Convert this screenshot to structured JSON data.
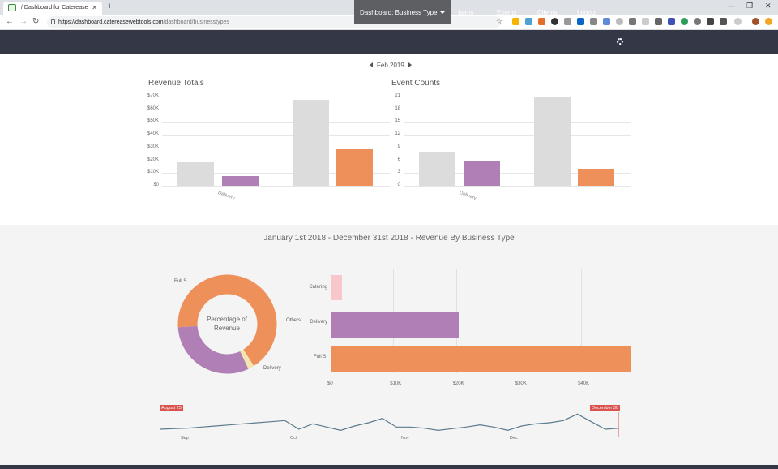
{
  "browser": {
    "tab_title": "/ Dashboard for Caterease",
    "url_host": "https://dashboard.catereasewebtools.com",
    "url_path": "/dashboard/businesstypes"
  },
  "nav": {
    "items": [
      {
        "label": "Dashboard: Business Type"
      },
      {
        "label": "Items"
      },
      {
        "label": "Events"
      },
      {
        "label": "Clients"
      },
      {
        "label": "Logout"
      }
    ]
  },
  "month_selector": {
    "label": "Feb 2019"
  },
  "colors": {
    "grey": "#dcdcdc",
    "purple": "#b07fb6",
    "orange": "#ee905a",
    "pink": "#f8c6cb",
    "cream": "#f4e4b0"
  },
  "chart_data": [
    {
      "type": "bar",
      "title": "Revenue Totals",
      "categories": [
        "Delivery",
        ""
      ],
      "yticks": [
        "$70K",
        "$60K",
        "$50K",
        "$40K",
        "$30K",
        "$20K",
        "$10K",
        "$0"
      ],
      "ylim": [
        0,
        70000
      ],
      "series": [
        {
          "values": [
            18500,
            67500
          ]
        },
        {
          "values": [
            7500,
            null
          ]
        },
        {
          "values": [
            null,
            28500
          ]
        }
      ]
    },
    {
      "type": "bar",
      "title": "Event Counts",
      "categories": [
        "Delivery",
        ""
      ],
      "yticks": [
        "21",
        "18",
        "15",
        "12",
        "9",
        "6",
        "3",
        "0"
      ],
      "ylim": [
        0,
        21
      ],
      "series": [
        {
          "values": [
            8,
            21
          ]
        },
        {
          "values": [
            6,
            null
          ]
        },
        {
          "values": [
            null,
            4
          ]
        }
      ]
    },
    {
      "type": "pie",
      "title": "January 1st 2018 - December 31st 2018 - Revenue By Business Type",
      "center_label": "Percentage of Revenue",
      "slices": [
        {
          "label": "Full S.",
          "value": 67
        },
        {
          "label": "Others",
          "value": 2
        },
        {
          "label": "Delivery",
          "value": 31
        }
      ]
    },
    {
      "type": "bar",
      "orientation": "horizontal",
      "categories": [
        "Catering",
        "Delivery",
        "Full S."
      ],
      "values": [
        1800,
        20500,
        48000
      ],
      "xticks": [
        "$0",
        "$10K",
        "$20K",
        "$30K",
        "$40K"
      ],
      "xlim": [
        0,
        48000
      ]
    },
    {
      "type": "line",
      "x_labels": [
        "Sep",
        "Oct",
        "Nov",
        "Dec"
      ],
      "range_start_label": "August 25",
      "range_end_label": "December 30",
      "values": [
        3,
        3.5,
        4,
        5,
        6,
        7,
        8,
        9,
        10,
        11,
        3,
        8,
        5,
        2,
        6,
        9,
        13,
        5,
        5,
        4,
        2,
        3.5,
        5,
        7,
        5,
        2,
        6,
        8,
        9,
        11,
        17,
        10,
        3,
        4
      ]
    }
  ]
}
